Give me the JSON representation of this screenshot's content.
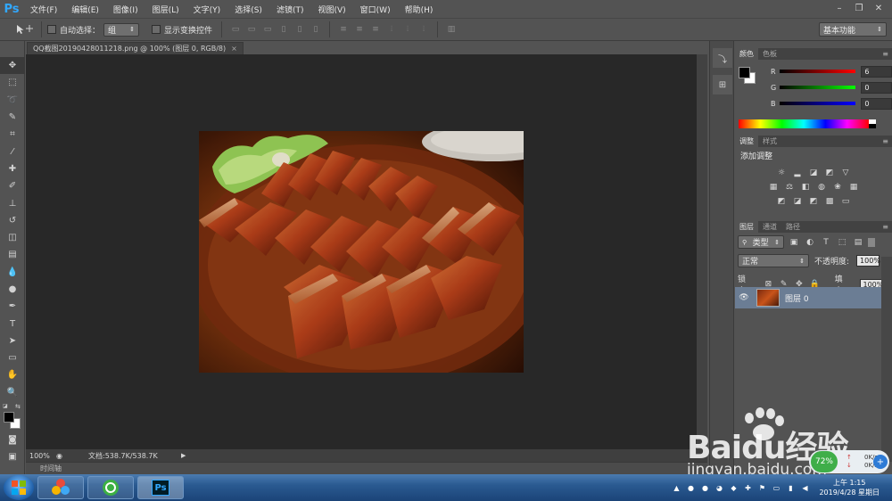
{
  "app": {
    "logo": "Ps"
  },
  "menu": [
    "文件(F)",
    "编辑(E)",
    "图像(I)",
    "图层(L)",
    "文字(Y)",
    "选择(S)",
    "滤镜(T)",
    "视图(V)",
    "窗口(W)",
    "帮助(H)"
  ],
  "window_controls": {
    "minimize": "–",
    "restore": "❐",
    "close": "✕"
  },
  "options": {
    "auto_select_label": "自动选择：",
    "auto_select_value": "组",
    "show_transform_label": "显示变换控件",
    "workspace": "基本功能"
  },
  "document": {
    "tab_title": "QQ截图20190428011218.png @ 100% (图层 0, RGB/8)",
    "zoom": "100%",
    "doc_size": "文档:538.7K/538.7K"
  },
  "timeline_label": "时间轴",
  "color_panel": {
    "tabs": [
      "颜色",
      "色板"
    ],
    "channels": [
      {
        "label": "R",
        "value": "6",
        "color": "#ff0000"
      },
      {
        "label": "G",
        "value": "0",
        "color": "#00ff00"
      },
      {
        "label": "B",
        "value": "0",
        "color": "#0000ff"
      }
    ]
  },
  "adjust_panel": {
    "tabs": [
      "调整",
      "样式"
    ],
    "title": "添加调整"
  },
  "layers_panel": {
    "tabs": [
      "图层",
      "通道",
      "路径"
    ],
    "filter_kind": "类型",
    "blend_mode": "正常",
    "opacity_label": "不透明度:",
    "opacity_value": "100%",
    "lock_label": "锁定:",
    "fill_label": "填充:",
    "fill_value": "100%",
    "layers": [
      {
        "name": "图层 0"
      }
    ]
  },
  "taskbar": {
    "clock_time": "上午 1:15",
    "clock_date": "2019/4/28 星期日"
  },
  "netmon": {
    "percent": "72%",
    "up": "0K/s",
    "down": "0K/s"
  },
  "watermark": {
    "line1": "Baidu经验",
    "line2": "jingyan.baidu.com"
  }
}
